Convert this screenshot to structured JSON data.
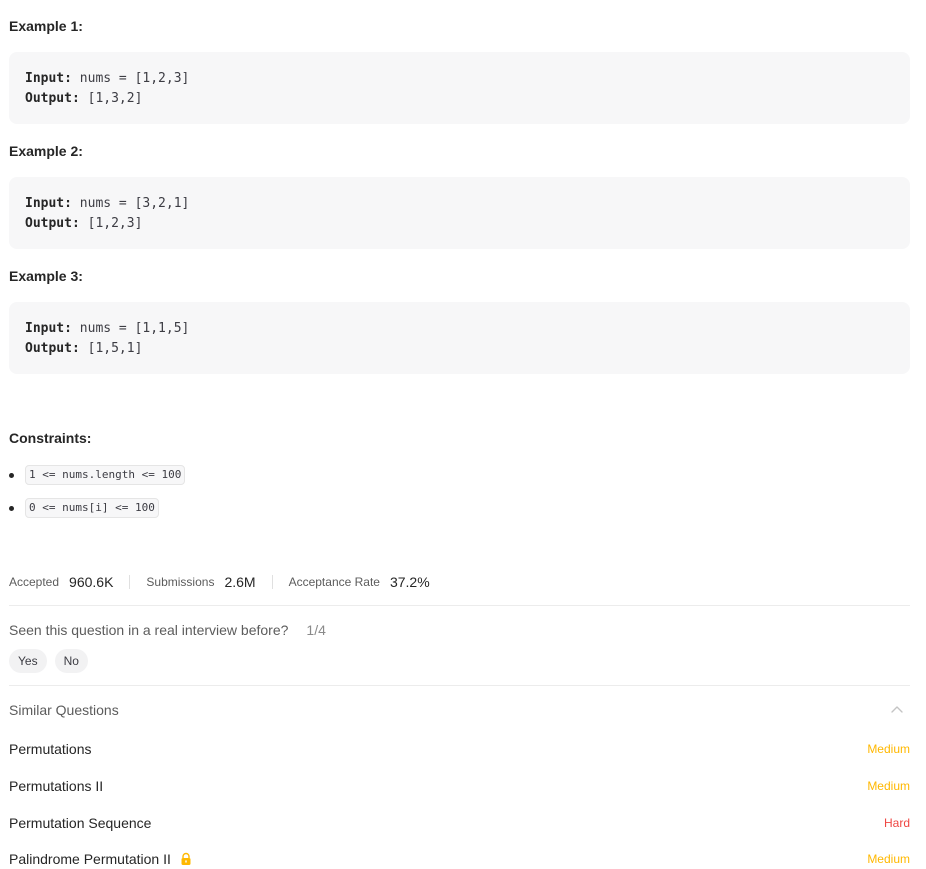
{
  "examples": [
    {
      "title": "Example 1:",
      "input_label": "Input:",
      "input_value": " nums = [1,2,3]",
      "output_label": "Output:",
      "output_value": " [1,3,2]"
    },
    {
      "title": "Example 2:",
      "input_label": "Input:",
      "input_value": " nums = [3,2,1]",
      "output_label": "Output:",
      "output_value": " [1,2,3]"
    },
    {
      "title": "Example 3:",
      "input_label": "Input:",
      "input_value": " nums = [1,1,5]",
      "output_label": "Output:",
      "output_value": " [1,5,1]"
    }
  ],
  "constraints": {
    "title": "Constraints:",
    "items": [
      "1 <= nums.length <= 100",
      "0 <= nums[i] <= 100"
    ]
  },
  "stats": {
    "accepted_label": "Accepted",
    "accepted_value": "960.6K",
    "submissions_label": "Submissions",
    "submissions_value": "2.6M",
    "rate_label": "Acceptance Rate",
    "rate_value": "37.2%"
  },
  "interview": {
    "question": "Seen this question in a real interview before?",
    "count": "1/4",
    "yes_label": "Yes",
    "no_label": "No"
  },
  "similar": {
    "title": "Similar Questions",
    "items": [
      {
        "title": "Permutations",
        "difficulty": "Medium",
        "locked": false
      },
      {
        "title": "Permutations II",
        "difficulty": "Medium",
        "locked": false
      },
      {
        "title": "Permutation Sequence",
        "difficulty": "Hard",
        "locked": false
      },
      {
        "title": "Palindrome Permutation II",
        "difficulty": "Medium",
        "locked": true
      }
    ]
  },
  "colors": {
    "medium": "#ffb800",
    "hard": "#ef4743",
    "lock": "#ffb800"
  },
  "icons": {
    "collapse": "chevron-up-icon",
    "premium": "lock-icon"
  }
}
